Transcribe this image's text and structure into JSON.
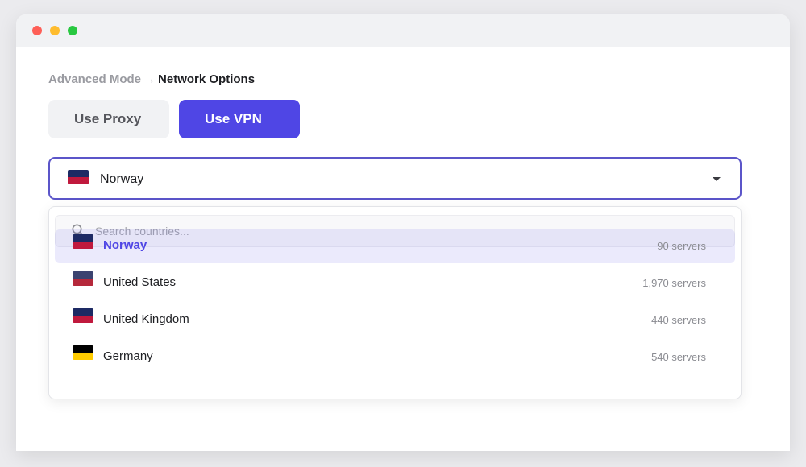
{
  "breadcrumb": {
    "parent": "Advanced Mode",
    "separator": "→",
    "current": "Network Options"
  },
  "mode_toggle": {
    "proxy_label": "Use Proxy",
    "vpn_label": "Use VPN",
    "active": "vpn"
  },
  "country_select": {
    "selected": "Norway",
    "flag_colors": [
      "#1d2a64",
      "#c0193d"
    ]
  },
  "dropdown": {
    "search_placeholder": "Search countries...",
    "options": [
      {
        "name": "Norway",
        "servers": "90 servers",
        "selected": true,
        "flag_colors": [
          "#1d2a64",
          "#c0193d"
        ]
      },
      {
        "name": "United States",
        "servers": "1,970 servers",
        "selected": false,
        "flag_colors": [
          "#3b4370",
          "#b5283b"
        ]
      },
      {
        "name": "United Kingdom",
        "servers": "440 servers",
        "selected": false,
        "flag_colors": [
          "#1d2a64",
          "#c0193d"
        ]
      },
      {
        "name": "Germany",
        "servers": "540 servers",
        "selected": false,
        "flag_colors": [
          "#000000",
          "#ffcc00"
        ]
      }
    ]
  },
  "colors": {
    "accent": "#4f46e5",
    "select_border": "#5b55c9",
    "selected_row_bg": "#ecebfc"
  },
  "icons": {
    "window_close": "red-dot-icon",
    "window_minimize": "yellow-dot-icon",
    "window_zoom": "green-dot-icon",
    "dropdown_caret": "chevron-down-icon",
    "search": "search-icon"
  }
}
